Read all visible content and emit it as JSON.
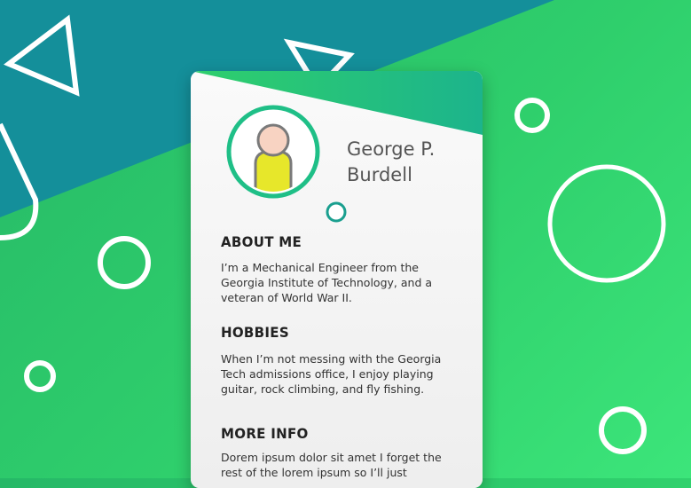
{
  "profile": {
    "name": "George P. Burdell",
    "about_title": "ABOUT ME",
    "about_text": "I’m a Mechanical Engineer from the Georgia Institute of Technology, and a veteran of World War II.",
    "hobbies_title": "HOBBIES",
    "hobbies_text": "When I’m not messing with the Georgia Tech admissions office, I enjoy playing guitar, rock climbing, and fly fishing.",
    "more_title": "MORE INFO",
    "more_text": "Dorem ipsum dolor sit amet I forget the rest of the lorem ipsum so I’ll just"
  },
  "colors": {
    "teal": "#148f9a",
    "green": "#2fcf6c",
    "accent": "#1fbf87",
    "avatar_shirt": "#e7e72a",
    "avatar_skin": "#f8d3c2",
    "avatar_outline": "#7a7a7a"
  },
  "icons": {
    "avatar": "person-avatar-icon",
    "shapes": "decorative-triangle-and-circle-shapes"
  }
}
